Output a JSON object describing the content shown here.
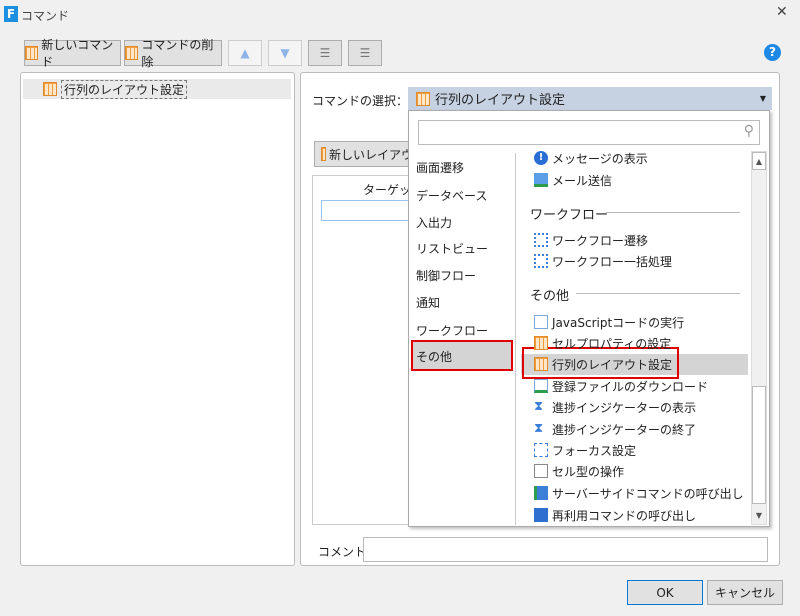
{
  "window": {
    "title": "コマンド",
    "close": "✕"
  },
  "toolbar": {
    "new_command": "新しいコマンド",
    "delete_command": "コマンドの削除",
    "help": "?"
  },
  "tree": {
    "items": [
      {
        "label": "行列のレイアウト設定",
        "icon": "grid-layout-icon"
      }
    ]
  },
  "editor": {
    "select_label": "コマンドの選択：",
    "selected_value": "行列のレイアウト設定",
    "new_layout_button": "新しいレイアウ",
    "table_header": "ターゲット",
    "comment_label": "コメント",
    "comment_value": ""
  },
  "dropdown": {
    "search_placeholder": "",
    "categories": [
      "画面遷移",
      "データベース",
      "入出力",
      "リストビュー",
      "制御フロー",
      "通知",
      "ワークフロー",
      "その他"
    ],
    "selected_category": "その他",
    "groups": {
      "top": [
        "メッセージの表示",
        "メール送信"
      ],
      "workflow_header": "ワークフロー",
      "workflow": [
        "ワークフロー遷移",
        "ワークフロー一括処理"
      ],
      "other_header": "その他",
      "other": [
        "JavaScriptコードの実行",
        "セルプロパティの設定",
        "行列のレイアウト設定",
        "登録ファイルのダウンロード",
        "進捗インジケーターの表示",
        "進捗インジケーターの終了",
        "フォーカス設定",
        "セル型の操作",
        "サーバーサイドコマンドの呼び出し",
        "再利用コマンドの呼び出し"
      ]
    },
    "selected_item": "行列のレイアウト設定"
  },
  "footer": {
    "ok": "OK",
    "cancel": "キャンセル"
  },
  "colors": {
    "accent": "#0078d7",
    "highlight_border": "#e00000",
    "combo_bg": "#c6d1e2"
  }
}
